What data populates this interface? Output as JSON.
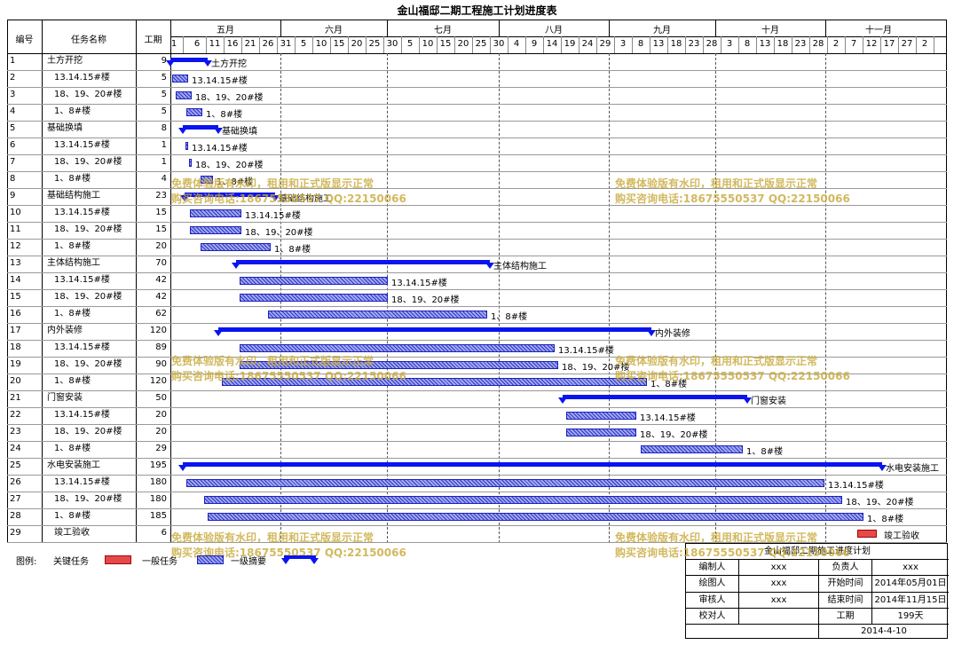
{
  "title": "金山福邸二期工程施工计划进度表",
  "headers": {
    "num": "编号",
    "name": "任务名称",
    "dur": "工期"
  },
  "months": [
    "五月",
    "六月",
    "七月",
    "八月",
    "九月",
    "十月",
    "十一月"
  ],
  "days": [
    "1",
    "6",
    "11",
    "16",
    "21",
    "26",
    "31",
    "5",
    "10",
    "15",
    "20",
    "25",
    "30",
    "5",
    "10",
    "15",
    "20",
    "25",
    "30",
    "4",
    "9",
    "14",
    "19",
    "24",
    "29",
    "3",
    "8",
    "13",
    "18",
    "23",
    "28",
    "3",
    "8",
    "13",
    "18",
    "23",
    "28",
    "2",
    "7",
    "12",
    "17",
    "27",
    "2"
  ],
  "tasks": [
    {
      "num": "1",
      "name": "土方开挖",
      "dur": "9",
      "summary": true,
      "label": "土方开挖"
    },
    {
      "num": "2",
      "name": "13.14.15#楼",
      "dur": "5",
      "label": "13.14.15#楼"
    },
    {
      "num": "3",
      "name": "18、19、20#楼",
      "dur": "5",
      "label": "18、19、20#楼"
    },
    {
      "num": "4",
      "name": "1、8#楼",
      "dur": "5",
      "label": "1、8#楼"
    },
    {
      "num": "5",
      "name": "基础换填",
      "dur": "8",
      "summary": true,
      "label": "基础换填"
    },
    {
      "num": "6",
      "name": "13.14.15#楼",
      "dur": "1",
      "label": "13.14.15#楼"
    },
    {
      "num": "7",
      "name": "18、19、20#楼",
      "dur": "1",
      "label": "18、19、20#楼"
    },
    {
      "num": "8",
      "name": "1、8#楼",
      "dur": "4",
      "label": "1、8#楼"
    },
    {
      "num": "9",
      "name": "基础结构施工",
      "dur": "23",
      "summary": true,
      "label": "基础结构施工"
    },
    {
      "num": "10",
      "name": "13.14.15#楼",
      "dur": "15",
      "label": "13.14.15#楼"
    },
    {
      "num": "11",
      "name": "18、19、20#楼",
      "dur": "15",
      "label": "18、19、20#楼"
    },
    {
      "num": "12",
      "name": "1、8#楼",
      "dur": "20",
      "label": "1、8#楼"
    },
    {
      "num": "13",
      "name": "主体结构施工",
      "dur": "70",
      "summary": true,
      "label": "主体结构施工"
    },
    {
      "num": "14",
      "name": "13.14.15#楼",
      "dur": "42",
      "label": "13.14.15#楼"
    },
    {
      "num": "15",
      "name": "18、19、20#楼",
      "dur": "42",
      "label": "18、19、20#楼"
    },
    {
      "num": "16",
      "name": "1、8#楼",
      "dur": "62",
      "label": "1、8#楼"
    },
    {
      "num": "17",
      "name": "内外装修",
      "dur": "120",
      "summary": true,
      "label": "内外装修"
    },
    {
      "num": "18",
      "name": "13.14.15#楼",
      "dur": "89",
      "label": "13.14.15#楼"
    },
    {
      "num": "19",
      "name": "18、19、20#楼",
      "dur": "90",
      "label": "18、19、20#楼"
    },
    {
      "num": "20",
      "name": "1、8#楼",
      "dur": "120",
      "label": "1、8#楼"
    },
    {
      "num": "21",
      "name": "门窗安装",
      "dur": "50",
      "summary": true,
      "label": "门窗安装"
    },
    {
      "num": "22",
      "name": "13.14.15#楼",
      "dur": "20",
      "label": "13.14.15#楼"
    },
    {
      "num": "23",
      "name": "18、19、20#楼",
      "dur": "20",
      "label": "18、19、20#楼"
    },
    {
      "num": "24",
      "name": "1、8#楼",
      "dur": "29",
      "label": "1、8#楼"
    },
    {
      "num": "25",
      "name": "水电安装施工",
      "dur": "195",
      "summary": true,
      "label": "水电安装施工"
    },
    {
      "num": "26",
      "name": "13.14.15#楼",
      "dur": "180",
      "label": "13.14.15#楼"
    },
    {
      "num": "27",
      "name": "18、19、20#楼",
      "dur": "180",
      "label": "18、19、20#楼"
    },
    {
      "num": "28",
      "name": "1、8#楼",
      "dur": "185",
      "label": "1、8#楼"
    },
    {
      "num": "29",
      "name": "竣工验收",
      "dur": "6",
      "milestone": true,
      "label": "竣工验收"
    }
  ],
  "watermark": {
    "line1": "免费体验版有水印，租用和正式版显示正常",
    "line2": "购买咨询电话:18675550537 QQ:22150066"
  },
  "legend": {
    "prefix": "图例:",
    "critical": "关键任务",
    "general": "一般任务",
    "summary": "一级摘要"
  },
  "info": {
    "plan_title": "金山福邸二期施工进度计划",
    "editor_label": "编制人",
    "editor": "xxx",
    "owner_label": "负责人",
    "owner": "xxx",
    "drawer_label": "绘图人",
    "drawer": "xxx",
    "start_label": "开始时间",
    "start": "2014年05月01日",
    "reviewer_label": "审核人",
    "reviewer": "xxx",
    "end_label": "结束时间",
    "end": "2014年11月15日",
    "proof_label": "校对人",
    "proof": "",
    "duration_label": "工期",
    "duration": "199天",
    "date": "2014-4-10"
  },
  "colors": {
    "summary": "#0a14f0",
    "task": "#2e36c8",
    "critical": "#e34a4a"
  }
}
